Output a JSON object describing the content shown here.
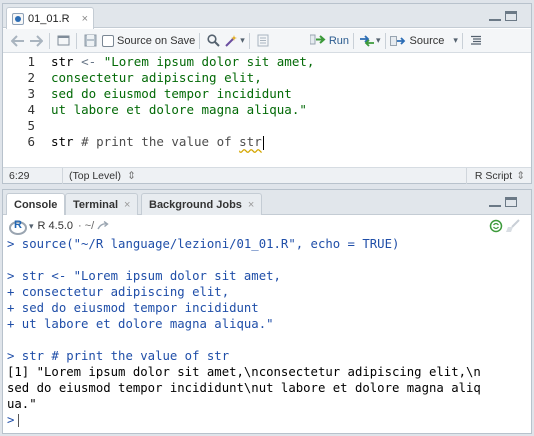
{
  "source_pane": {
    "tab_label": "01_01.R",
    "tab_close": "×",
    "toolbar": {
      "source_on_save_label": "Source on Save",
      "run_label": "Run",
      "source_label": "Source",
      "dropdown_arrow": "▾"
    },
    "editor": {
      "line_numbers": [
        "1",
        "2",
        "3",
        "4",
        "5",
        "6"
      ],
      "lines": [
        [
          {
            "t": "str",
            "c": "c-id"
          },
          {
            "t": " <- ",
            "c": "c-op"
          },
          {
            "t": "\"Lorem ipsum dolor sit amet,",
            "c": "c-str"
          }
        ],
        [
          {
            "t": "consectetur adipiscing elit,",
            "c": "c-str"
          }
        ],
        [
          {
            "t": "sed do eiusmod tempor incididunt",
            "c": "c-str"
          }
        ],
        [
          {
            "t": "ut labore et dolore magna aliqua.\"",
            "c": "c-str"
          }
        ],
        [],
        [
          {
            "t": "str",
            "c": "c-id"
          },
          {
            "t": " # print the value of ",
            "c": "c-com"
          },
          {
            "t": "str",
            "c": "c-com squig"
          }
        ]
      ]
    },
    "status": {
      "cursor_pos": "6:29",
      "scope": "(Top Level)",
      "scope_arrow": "⇕",
      "file_type": "R Script",
      "file_type_arrow": "⇕"
    }
  },
  "console_pane": {
    "tabs": [
      {
        "label": "Console",
        "active": true,
        "closable": false
      },
      {
        "label": "Terminal",
        "active": false,
        "closable": true
      },
      {
        "label": "Background Jobs",
        "active": false,
        "closable": true
      }
    ],
    "r_version": "R 4.5.0",
    "working_dir": "· ~/",
    "lines": [
      {
        "t": "> source(\"~/R language/lezioni/01_01.R\", echo = TRUE)",
        "c": "k-cmd"
      },
      {
        "t": "",
        "c": "k-cmd"
      },
      {
        "t": "> str <- \"Lorem ipsum dolor sit amet,",
        "c": "k-cmd"
      },
      {
        "t": "+ consectetur adipiscing elit,",
        "c": "k-cmd"
      },
      {
        "t": "+ sed do eiusmod tempor incididunt",
        "c": "k-cmd"
      },
      {
        "t": "+ ut labore et dolore magna aliqua.\"",
        "c": "k-cmd"
      },
      {
        "t": "",
        "c": "k-cmd"
      },
      {
        "t": "> str # print the value of str",
        "c": "k-cmd"
      },
      {
        "t": "[1] \"Lorem ipsum dolor sit amet,\\nconsectetur adipiscing elit,\\n",
        "c": "k-out"
      },
      {
        "t": "sed do eiusmod tempor incididunt\\nut labore et dolore magna aliq",
        "c": "k-out"
      },
      {
        "t": "ua.\"",
        "c": "k-out"
      }
    ],
    "prompt": ">"
  },
  "colors": {
    "command_text": "#1f4ea8",
    "string_text": "#036a07",
    "accent": "#2c6db5"
  }
}
